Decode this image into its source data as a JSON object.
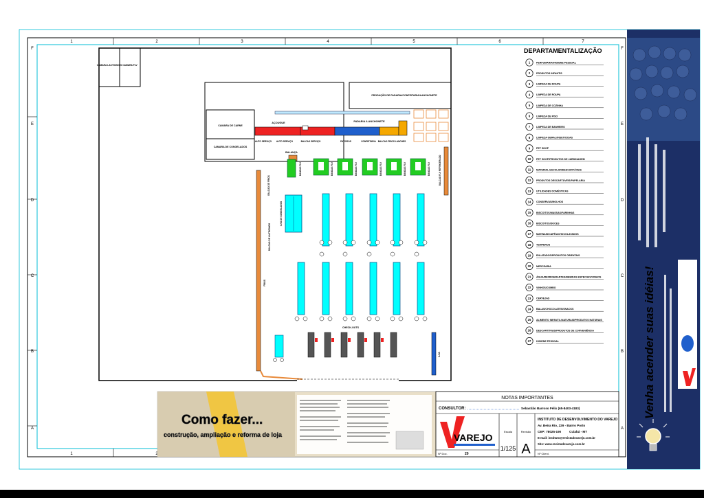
{
  "frame": {
    "columns": [
      "1",
      "2",
      "3",
      "4",
      "5",
      "6",
      "7"
    ],
    "rows": [
      "F",
      "E",
      "D",
      "C",
      "B",
      "A"
    ]
  },
  "plan": {
    "rooms": {
      "camara_lacticinios": "CAMARA LACTICINIOS",
      "camara_flv": "CAMARA FLV",
      "camara_carne": "CAMARA DE CARNE",
      "camara_congelados": "CAMARA DE CONGELADOS",
      "producao_padaria": "PRODUÇÃO DE PADARIA/CONFEITARIA/LANCHONETE",
      "acougue": "AÇOUGUE",
      "padaria_lanchonete": "PADARIA /LANCHONETE"
    },
    "counters": {
      "auto_servico": "AUTO SERVIÇO",
      "auto_servico_2": "AUTO SERVIÇO",
      "balcao_servico": "BALCAO SERVIÇO",
      "patisserie": "PATISSOS",
      "confeitaria": "CONFEITARIA",
      "balcao_frios": "BALCAO FRIOS LANCHES"
    },
    "fixtures": {
      "balanca": "BALANÇA",
      "check_outs": "CHECK-OUTS",
      "ilha_congelados": "ILHA DE CONGELADOS",
      "ilha_label": "ILHA",
      "gondola_flv": "BANCAS FLV",
      "frios_wall": "BALCAO DE FRIOS",
      "lacticinios_wall": "BALCAO DE LACTICINIOS",
      "frios_wall2": "FRIOS",
      "cliente_wall": "BALCAO FLV REFRIGERADO"
    }
  },
  "legend": {
    "title": "DEPARTAMENTALIZAÇÃO",
    "items": [
      {
        "n": "1",
        "label": "PERFUMARIA/HIGIENE PESSOAL"
      },
      {
        "n": "2",
        "label": "PRODUTOS INFANTIS"
      },
      {
        "n": "3",
        "label": "LIMPEZA DE ROUPA"
      },
      {
        "n": "4",
        "label": "LIMPEZA DE ROUPA"
      },
      {
        "n": "5",
        "label": "LIMPEZA DE COZINHA"
      },
      {
        "n": "6",
        "label": "LIMPEZA DE PISO"
      },
      {
        "n": "7",
        "label": "LIMPEZA DE BANHEIRO"
      },
      {
        "n": "8",
        "label": "LIMPEZA GERAL/INSETICIDAS"
      },
      {
        "n": "9",
        "label": "PET SHOP"
      },
      {
        "n": "10",
        "label": "PET SHOP/PRODUTOS DE JARDINAGEM"
      },
      {
        "n": "11",
        "label": "MATERIAL ESCOLAR/DESCARTÁVEIS"
      },
      {
        "n": "12",
        "label": "PRODUTOS DESCARTÁVEIS/PAPELARIA"
      },
      {
        "n": "13",
        "label": "UTILIDADES DOMÉSTICAS"
      },
      {
        "n": "14",
        "label": "CONSERVAS/MOLHOS"
      },
      {
        "n": "15",
        "label": "BISCOITOS/MASSAS/FARINHAS"
      },
      {
        "n": "16",
        "label": "BISCOITOS/DOCES"
      },
      {
        "n": "17",
        "label": "MATINAIS/CAFÉ/ACHOCOLATADOS"
      },
      {
        "n": "18",
        "label": "TEMPEROS"
      },
      {
        "n": "19",
        "label": "ENLATADOS/PRODUTOS ORIENTAIS"
      },
      {
        "n": "20",
        "label": "MERCEARIA"
      },
      {
        "n": "21",
        "label": "ÁGUA/REFRIGERANTES/BEBIDAS ESPECIAIS/VINHOS"
      },
      {
        "n": "22",
        "label": "VINHOS/COMBO"
      },
      {
        "n": "23",
        "label": "CERVEJAS"
      },
      {
        "n": "24",
        "label": "BALAS/CHOCOLATES/SNACKS"
      },
      {
        "n": "25",
        "label": "ALIMENTO INFANTIL/NATURAIS/PRODUTOS NATURAIS"
      },
      {
        "n": "26",
        "label": "DESCARTÁVEIS/PRODUTOS DE CONVENIÊNCIA"
      },
      {
        "n": "27",
        "label": "HIGIENE PESSOAL"
      }
    ]
  },
  "ad": {
    "headline": "Como fazer...",
    "subline": "construção, ampliação e reforma de loja"
  },
  "notes": {
    "title": "NOTAS IMPORTANTES",
    "consultor_label": "CONSULTOR:",
    "consultor_value": "Sebastião Barroso Félix (65-8403-4183)",
    "institute": "INSTITUTO DE DESENVOLVIMENTO DO VAREJO",
    "address": "Av. Beira Rio, 229 - Bairro Porto",
    "cep": "CEP: 78025-190",
    "city": "Cuiabá - MT",
    "email": "E-mail: instituto@revistadovarejo.com.br",
    "site": "Site: www.revistadovarejo.com.br",
    "logo": "VAREJO",
    "escala_label": "Escala",
    "escala_value": "1/125",
    "revisao_label": "Revisão",
    "revisao_value": "A",
    "doc_label": "Nº Doc.",
    "doc_value": "20",
    "client_label": "Nº Client."
  },
  "banner": {
    "slogan": "Venha acender suas idéias!"
  },
  "colors": {
    "frame": "#00bcd4",
    "gondola": "#00ffff",
    "flv": "#22cc22",
    "red": "#ee2222",
    "blue": "#1f5fcc",
    "yellow": "#f5a800",
    "wood": "#e88a3a",
    "banner": "#1c2f66"
  }
}
